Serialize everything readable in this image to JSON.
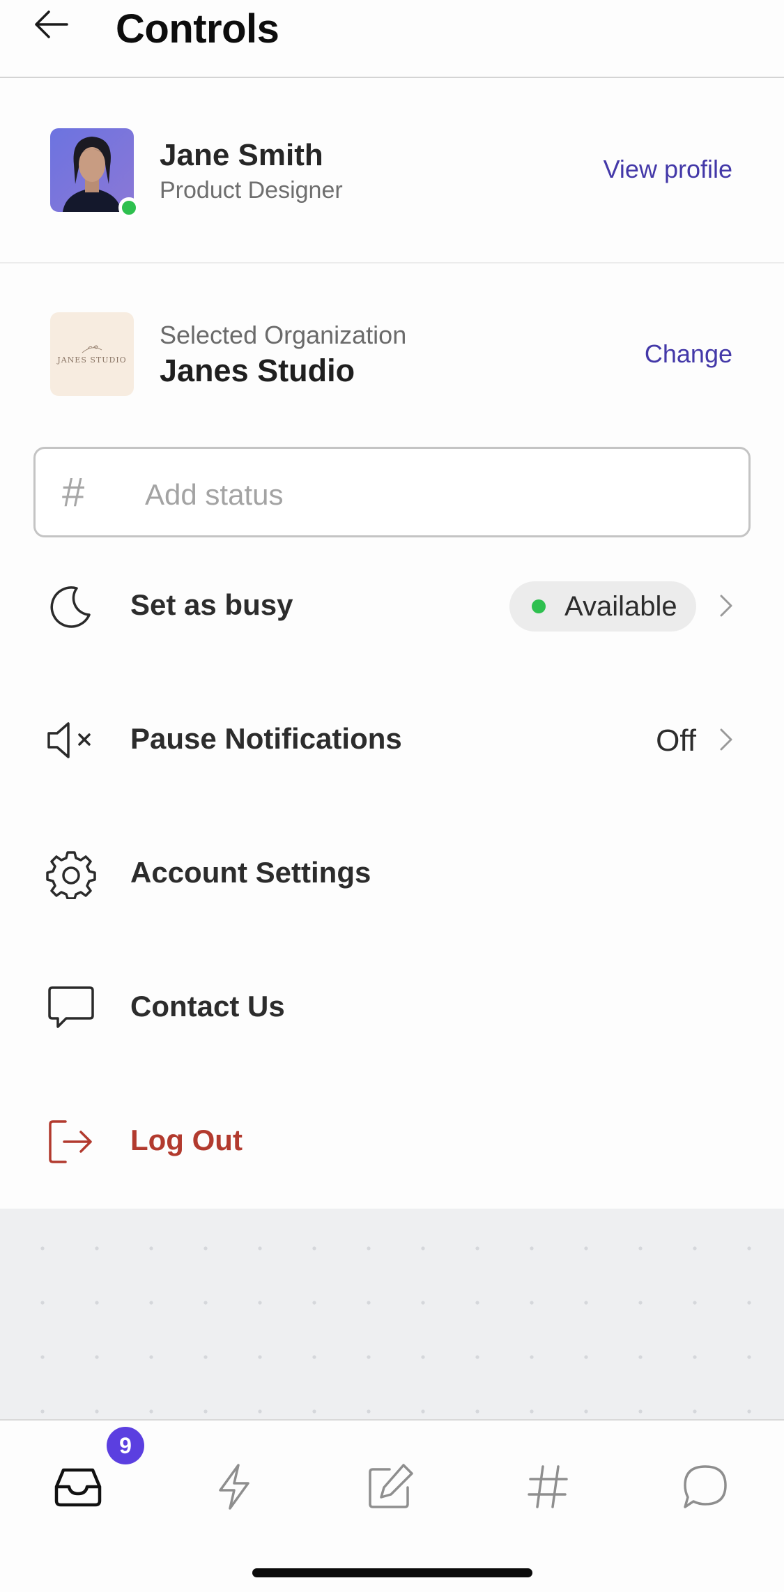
{
  "header": {
    "title": "Controls",
    "back_icon": "arrow-left-icon"
  },
  "profile": {
    "name": "Jane Smith",
    "role": "Product Designer",
    "view_profile_label": "View profile",
    "presence_color": "#2ec04f"
  },
  "organization": {
    "label": "Selected Organization",
    "name": "Janes Studio",
    "change_label": "Change",
    "logo_text": "JANES STUDIO"
  },
  "status_input": {
    "icon": "hash-icon",
    "placeholder": "Add status",
    "value": ""
  },
  "menu": {
    "busy": {
      "label": "Set as busy",
      "icon": "moon-icon",
      "status": "Available",
      "status_color": "#2ec04f"
    },
    "notifications": {
      "label": "Pause Notifications",
      "icon": "speaker-mute-icon",
      "value": "Off"
    },
    "settings": {
      "label": "Account Settings",
      "icon": "gear-icon"
    },
    "contact": {
      "label": "Contact Us",
      "icon": "chat-bubble-icon"
    },
    "logout": {
      "label": "Log Out",
      "icon": "logout-icon",
      "color": "#b23a2e"
    }
  },
  "tabbar": {
    "tabs": [
      {
        "name": "inbox",
        "icon": "inbox-icon",
        "badge": "9",
        "active": true
      },
      {
        "name": "activity",
        "icon": "lightning-icon",
        "active": false
      },
      {
        "name": "compose",
        "icon": "compose-icon",
        "active": false
      },
      {
        "name": "channels",
        "icon": "hash-icon",
        "active": false
      },
      {
        "name": "messages",
        "icon": "chat-icon",
        "active": false
      }
    ],
    "badge_color": "#5b3fe0"
  },
  "colors": {
    "accent_link": "#4338a8",
    "danger": "#b23a2e"
  }
}
